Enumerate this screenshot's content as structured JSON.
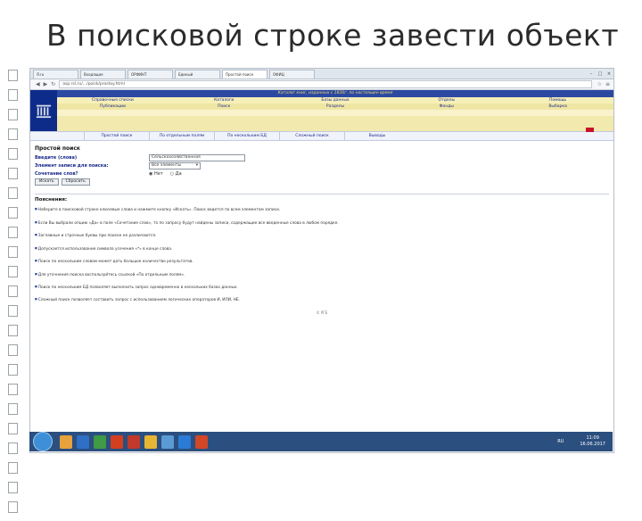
{
  "slide_title": "В поисковой строке завести объект",
  "browser": {
    "tabs": [
      {
        "label": "Я.ru"
      },
      {
        "label": "Входящие"
      },
      {
        "label": "ОРФИНТ"
      },
      {
        "label": "Единый"
      },
      {
        "label": "Простой поиск"
      },
      {
        "label": "ОФИЦ"
      }
    ],
    "window_controls": [
      "–",
      "□",
      "×"
    ],
    "url": "asp.rsl.ru/.../poisk/prostoy.html"
  },
  "site": {
    "banner": "Каталог книг, изданных с 1830г. по настоящее время",
    "menu_row1": [
      "Справочные списки",
      "Каталоги",
      "Базы данных",
      "Отделы",
      "Помощь"
    ],
    "menu_row2": [
      "Публикации",
      "Поиск",
      "Разделы",
      "Фонды",
      "Выборка"
    ],
    "search_tabs": [
      "Простой поиск",
      "По отдельным полям",
      "По нескольким БД",
      "Сложный поиск",
      "Выводы"
    ]
  },
  "form": {
    "title": "Простой поиск",
    "query_label": "Введите (слова)",
    "query_value": "Сельскохозяйственная",
    "element_label": "Элемент записи для поиска:",
    "element_value": "Все элементы",
    "combine_label": "Сочетание слов?",
    "radio_no": "Нет",
    "radio_yes": "Да",
    "search_btn": "Искать",
    "clear_btn": "Сбросить"
  },
  "notes": {
    "title": "Пояснения:",
    "items": [
      "Наберите в поисковой строке ключевые слова и нажмите кнопку «Искать». Поиск ведется по всем элементам записи.",
      "Если Вы выбрали опцию «Да» в поле «Сочетание слов», то по запросу будут найдены записи, содержащие все введенные слова в любом порядке.",
      "Заглавные и строчные буквы при поиске не различаются.",
      "Допускается использование символа усечения «*» в конце слова.",
      "Поиск по нескольким словам может дать большое количество результатов.",
      "Для уточнения поиска воспользуйтесь ссылкой «По отдельным полям».",
      "Поиск по нескольким БД позволяет выполнить запрос одновременно в нескольких базах данных.",
      "Сложный поиск позволяет составить запрос с использованием логических операторов И, ИЛИ, НЕ."
    ],
    "footer": "© РГБ"
  },
  "taskbar": {
    "language": "RU",
    "time": "11:09",
    "date": "16.06.2017"
  },
  "colors": {
    "logo_bg": "#0d2c8a",
    "banner_bg": "#2c49a2",
    "banner_text": "#f4d96b",
    "menu_bg": "#f7efb8",
    "link": "#1a2a8c",
    "taskbar": "#2b4f7f"
  }
}
